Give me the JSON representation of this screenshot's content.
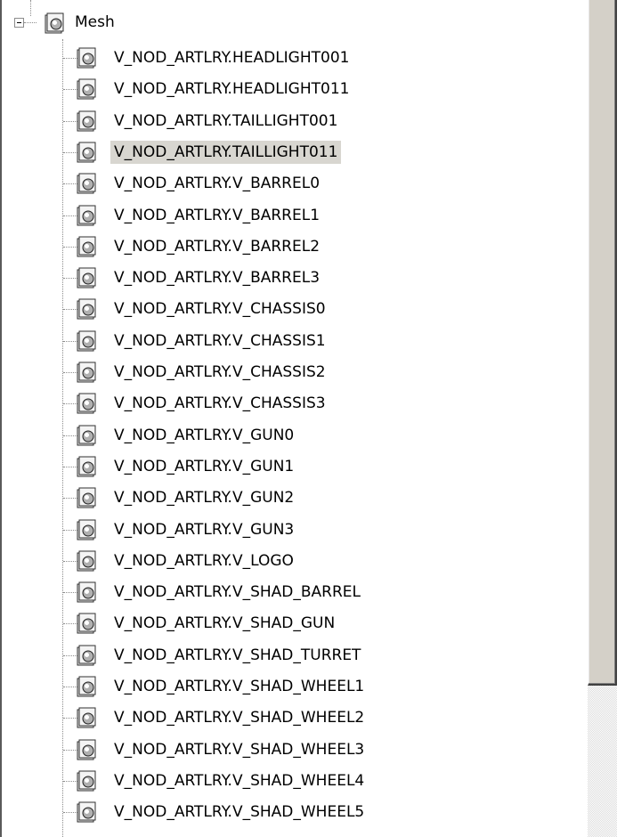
{
  "tree": {
    "root": {
      "label": "Mesh",
      "icon": "mesh-object-icon",
      "expanded": true
    },
    "children": [
      {
        "label": "V_NOD_ARTLRY.HEADLIGHT001"
      },
      {
        "label": "V_NOD_ARTLRY.HEADLIGHT011"
      },
      {
        "label": "V_NOD_ARTLRY.TAILLIGHT001"
      },
      {
        "label": "V_NOD_ARTLRY.TAILLIGHT011",
        "selected": true
      },
      {
        "label": "V_NOD_ARTLRY.V_BARREL0"
      },
      {
        "label": "V_NOD_ARTLRY.V_BARREL1"
      },
      {
        "label": "V_NOD_ARTLRY.V_BARREL2"
      },
      {
        "label": "V_NOD_ARTLRY.V_BARREL3"
      },
      {
        "label": "V_NOD_ARTLRY.V_CHASSIS0"
      },
      {
        "label": "V_NOD_ARTLRY.V_CHASSIS1"
      },
      {
        "label": "V_NOD_ARTLRY.V_CHASSIS2"
      },
      {
        "label": "V_NOD_ARTLRY.V_CHASSIS3"
      },
      {
        "label": "V_NOD_ARTLRY.V_GUN0"
      },
      {
        "label": "V_NOD_ARTLRY.V_GUN1"
      },
      {
        "label": "V_NOD_ARTLRY.V_GUN2"
      },
      {
        "label": "V_NOD_ARTLRY.V_GUN3"
      },
      {
        "label": "V_NOD_ARTLRY.V_LOGO"
      },
      {
        "label": "V_NOD_ARTLRY.V_SHAD_BARREL"
      },
      {
        "label": "V_NOD_ARTLRY.V_SHAD_GUN"
      },
      {
        "label": "V_NOD_ARTLRY.V_SHAD_TURRET"
      },
      {
        "label": "V_NOD_ARTLRY.V_SHAD_WHEEL1"
      },
      {
        "label": "V_NOD_ARTLRY.V_SHAD_WHEEL2"
      },
      {
        "label": "V_NOD_ARTLRY.V_SHAD_WHEEL3"
      },
      {
        "label": "V_NOD_ARTLRY.V_SHAD_WHEEL4"
      },
      {
        "label": "V_NOD_ARTLRY.V_SHAD_WHEEL5"
      }
    ]
  },
  "colors": {
    "selection": "#d8d6d0",
    "tree_line": "#8c8c8c",
    "scrollbar_face": "#d4d0c8"
  }
}
